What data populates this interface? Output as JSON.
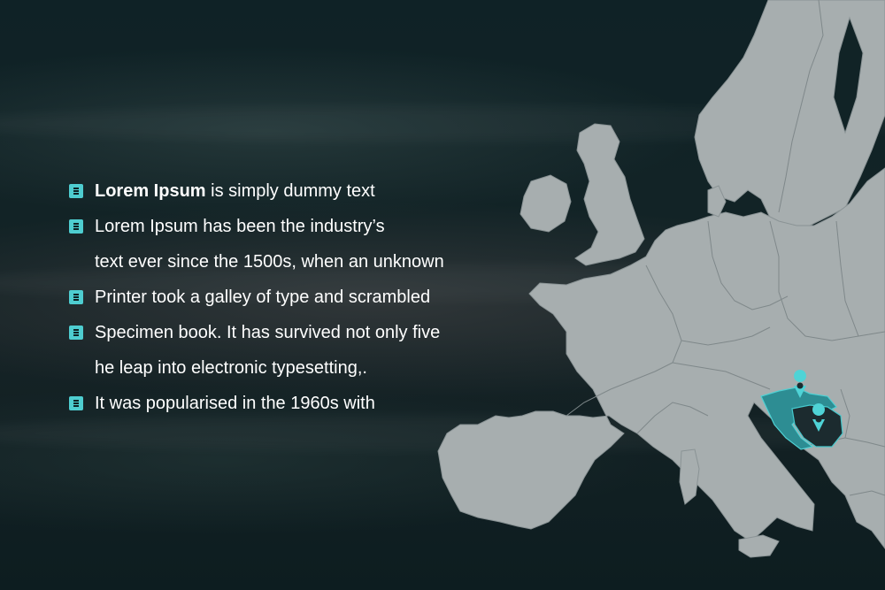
{
  "bullets": [
    {
      "bold": "Lorem Ipsum",
      "text": " is simply dummy text",
      "icon": "list-bullet-icon"
    },
    {
      "bold": "",
      "text": "Lorem Ipsum has been the industry’s",
      "icon": "list-bullet-icon"
    },
    {
      "bold": "",
      "text": "text ever since the 1500s, when an unknown",
      "icon": ""
    },
    {
      "bold": "",
      "text": "Printer took a galley of type and scrambled",
      "icon": "list-bullet-icon"
    },
    {
      "bold": "",
      "text": "Specimen book. It has survived not only five",
      "icon": "list-bullet-icon"
    },
    {
      "bold": "",
      "text": "he leap into electronic typesetting,.",
      "icon": ""
    },
    {
      "bold": "",
      "text": "It was popularised in the 1960s with",
      "icon": "list-bullet-icon"
    }
  ],
  "map": {
    "highlight_colors": {
      "primary": "#2d8d93",
      "secondary": "#1c2b2f",
      "accent": "#4fd3d6"
    },
    "markers": [
      "location-pin-icon",
      "location-pin-icon"
    ],
    "land_color": "#a7aeaf"
  }
}
